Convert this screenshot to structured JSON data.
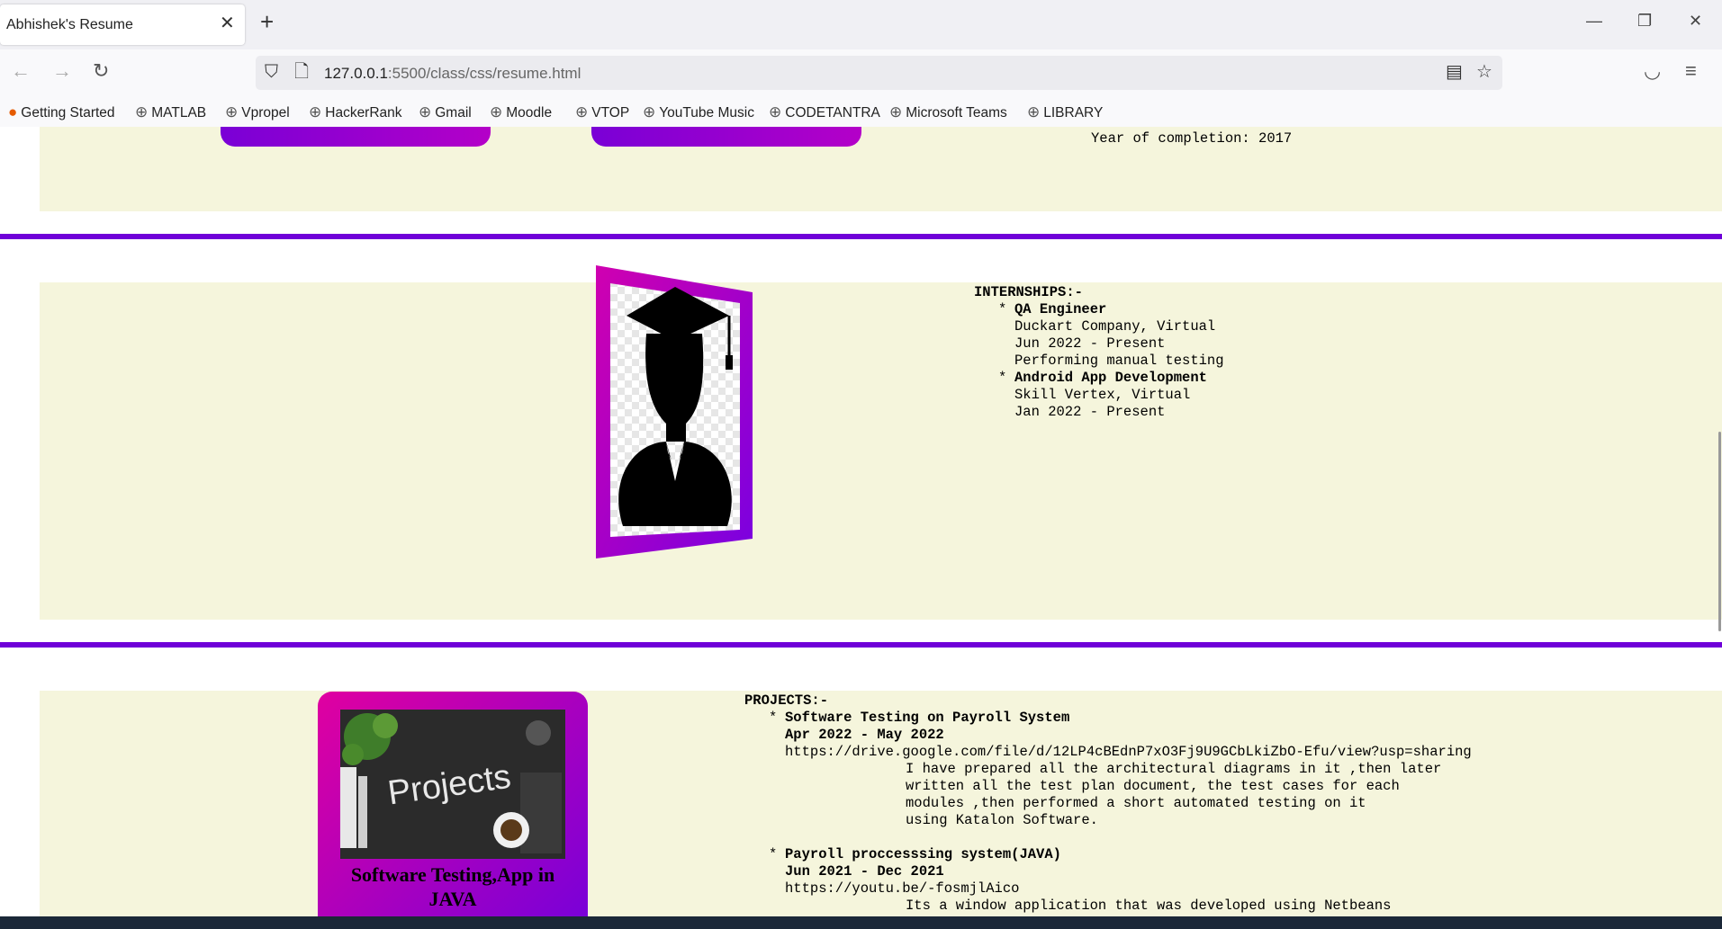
{
  "browser": {
    "tab_title": "Abhishek's Resume",
    "tab_close": "✕",
    "new_tab": "+",
    "win_min": "—",
    "win_restore": "❐",
    "win_close": "✕",
    "back": "←",
    "forward": "→",
    "reload": "↻",
    "url_host": "127.0.0.1",
    "url_rest": ":5500/class/css/resume.html",
    "shield": "⛉",
    "page": "🗋",
    "reader": "▤",
    "star": "☆",
    "pocket": "◡",
    "menu": "≡",
    "bookmarks": [
      {
        "label": "Getting Started",
        "icon": "firefox-icon"
      },
      {
        "label": "MATLAB",
        "icon": "globe-icon"
      },
      {
        "label": "Vpropel",
        "icon": "globe-icon"
      },
      {
        "label": "HackerRank",
        "icon": "globe-icon"
      },
      {
        "label": "Gmail",
        "icon": "globe-icon"
      },
      {
        "label": "Moodle",
        "icon": "globe-icon"
      },
      {
        "label": "VTOP",
        "icon": "globe-icon"
      },
      {
        "label": "YouTube Music",
        "icon": "globe-icon"
      },
      {
        "label": "CODETANTRA",
        "icon": "globe-icon"
      },
      {
        "label": "Microsoft Teams",
        "icon": "globe-icon"
      },
      {
        "label": "LIBRARY",
        "icon": "globe-icon"
      }
    ]
  },
  "education": {
    "year_line": "Year of completion: 2017"
  },
  "internships": {
    "heading": "INTERNSHIPS:-",
    "items": [
      {
        "bullet": "*",
        "title": "QA Engineer",
        "company": "Duckart Company, Virtual",
        "dates": "Jun 2022 - Present",
        "desc": "Performing manual testing"
      },
      {
        "bullet": "*",
        "title": "Android App Development",
        "company": "Skill Vertex, Virtual",
        "dates": "Jan 2022 - Present"
      }
    ]
  },
  "projects": {
    "heading": "PROJECTS:-",
    "card_image_text": "Projects",
    "card_caption": "Software Testing,App in JAVA",
    "items": [
      {
        "bullet": "*",
        "title": "Software Testing on Payroll System",
        "dates": "Apr 2022 - May 2022",
        "link": "https://drive.google.com/file/d/12LP4cBEdnP7xO3Fj9U9GCbLkiZbO-Efu/view?usp=sharing",
        "desc": [
          "I have prepared all the architectural diagrams in it ,then later",
          "written all the test plan document, the test cases for each",
          "modules ,then performed a short automated testing on it",
          "using Katalon Software."
        ]
      },
      {
        "bullet": "*",
        "title": "Payroll proccesssing system(JAVA)",
        "dates": "Jun 2021 - Dec 2021",
        "link": "https://youtu.be/-fosmjlAico",
        "desc": [
          "Its a window application that was developed using Netbeans"
        ]
      }
    ]
  }
}
